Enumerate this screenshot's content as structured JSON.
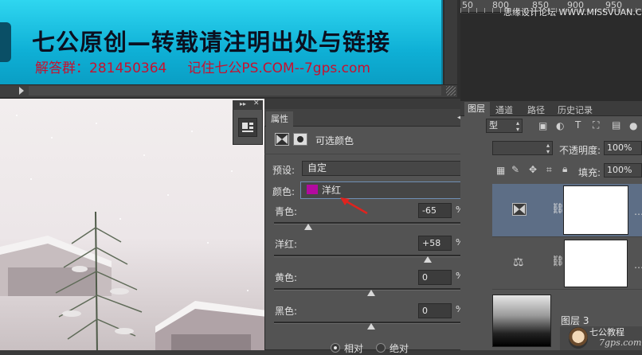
{
  "banner": {
    "title": "七公原创—转载请注明出处与链接",
    "qa_label": "解答群：281450364",
    "url_text": "记住七公PS.COM--7gps.com",
    "bg_color": "#10b4d8"
  },
  "ruler": {
    "marks": [
      "50",
      "800",
      "850",
      "900",
      "950"
    ]
  },
  "watermark_top": "思缘设计论坛 WWW.MISSVUAN.COM",
  "properties": {
    "tab_label": "属性",
    "title": "可选颜色",
    "preset_label": "预设:",
    "preset_value": "自定",
    "colors_label": "颜色:",
    "colors_value": "洋红",
    "colors_swatch": "#b20aa0",
    "sliders": [
      {
        "label": "青色:",
        "value": "-65",
        "unit": "%",
        "level": -65
      },
      {
        "label": "洋红:",
        "value": "+58",
        "unit": "%",
        "level": 58
      },
      {
        "label": "黄色:",
        "value": "0",
        "unit": "%",
        "level": 0
      },
      {
        "label": "黑色:",
        "value": "0",
        "unit": "%",
        "level": 0
      }
    ],
    "method_relative": "相对",
    "method_absolute": "绝对"
  },
  "layers_panel": {
    "tabs": [
      "图层",
      "通道",
      "路径",
      "历史记录"
    ],
    "kind_value": "型",
    "opacity_label": "不透明度:",
    "opacity_value": "100%",
    "fill_label": "填充:",
    "fill_value": "100%",
    "layer3_name": "图层 3"
  },
  "watermark_bottom": {
    "name": "七公教程",
    "url": "7gps.com"
  }
}
